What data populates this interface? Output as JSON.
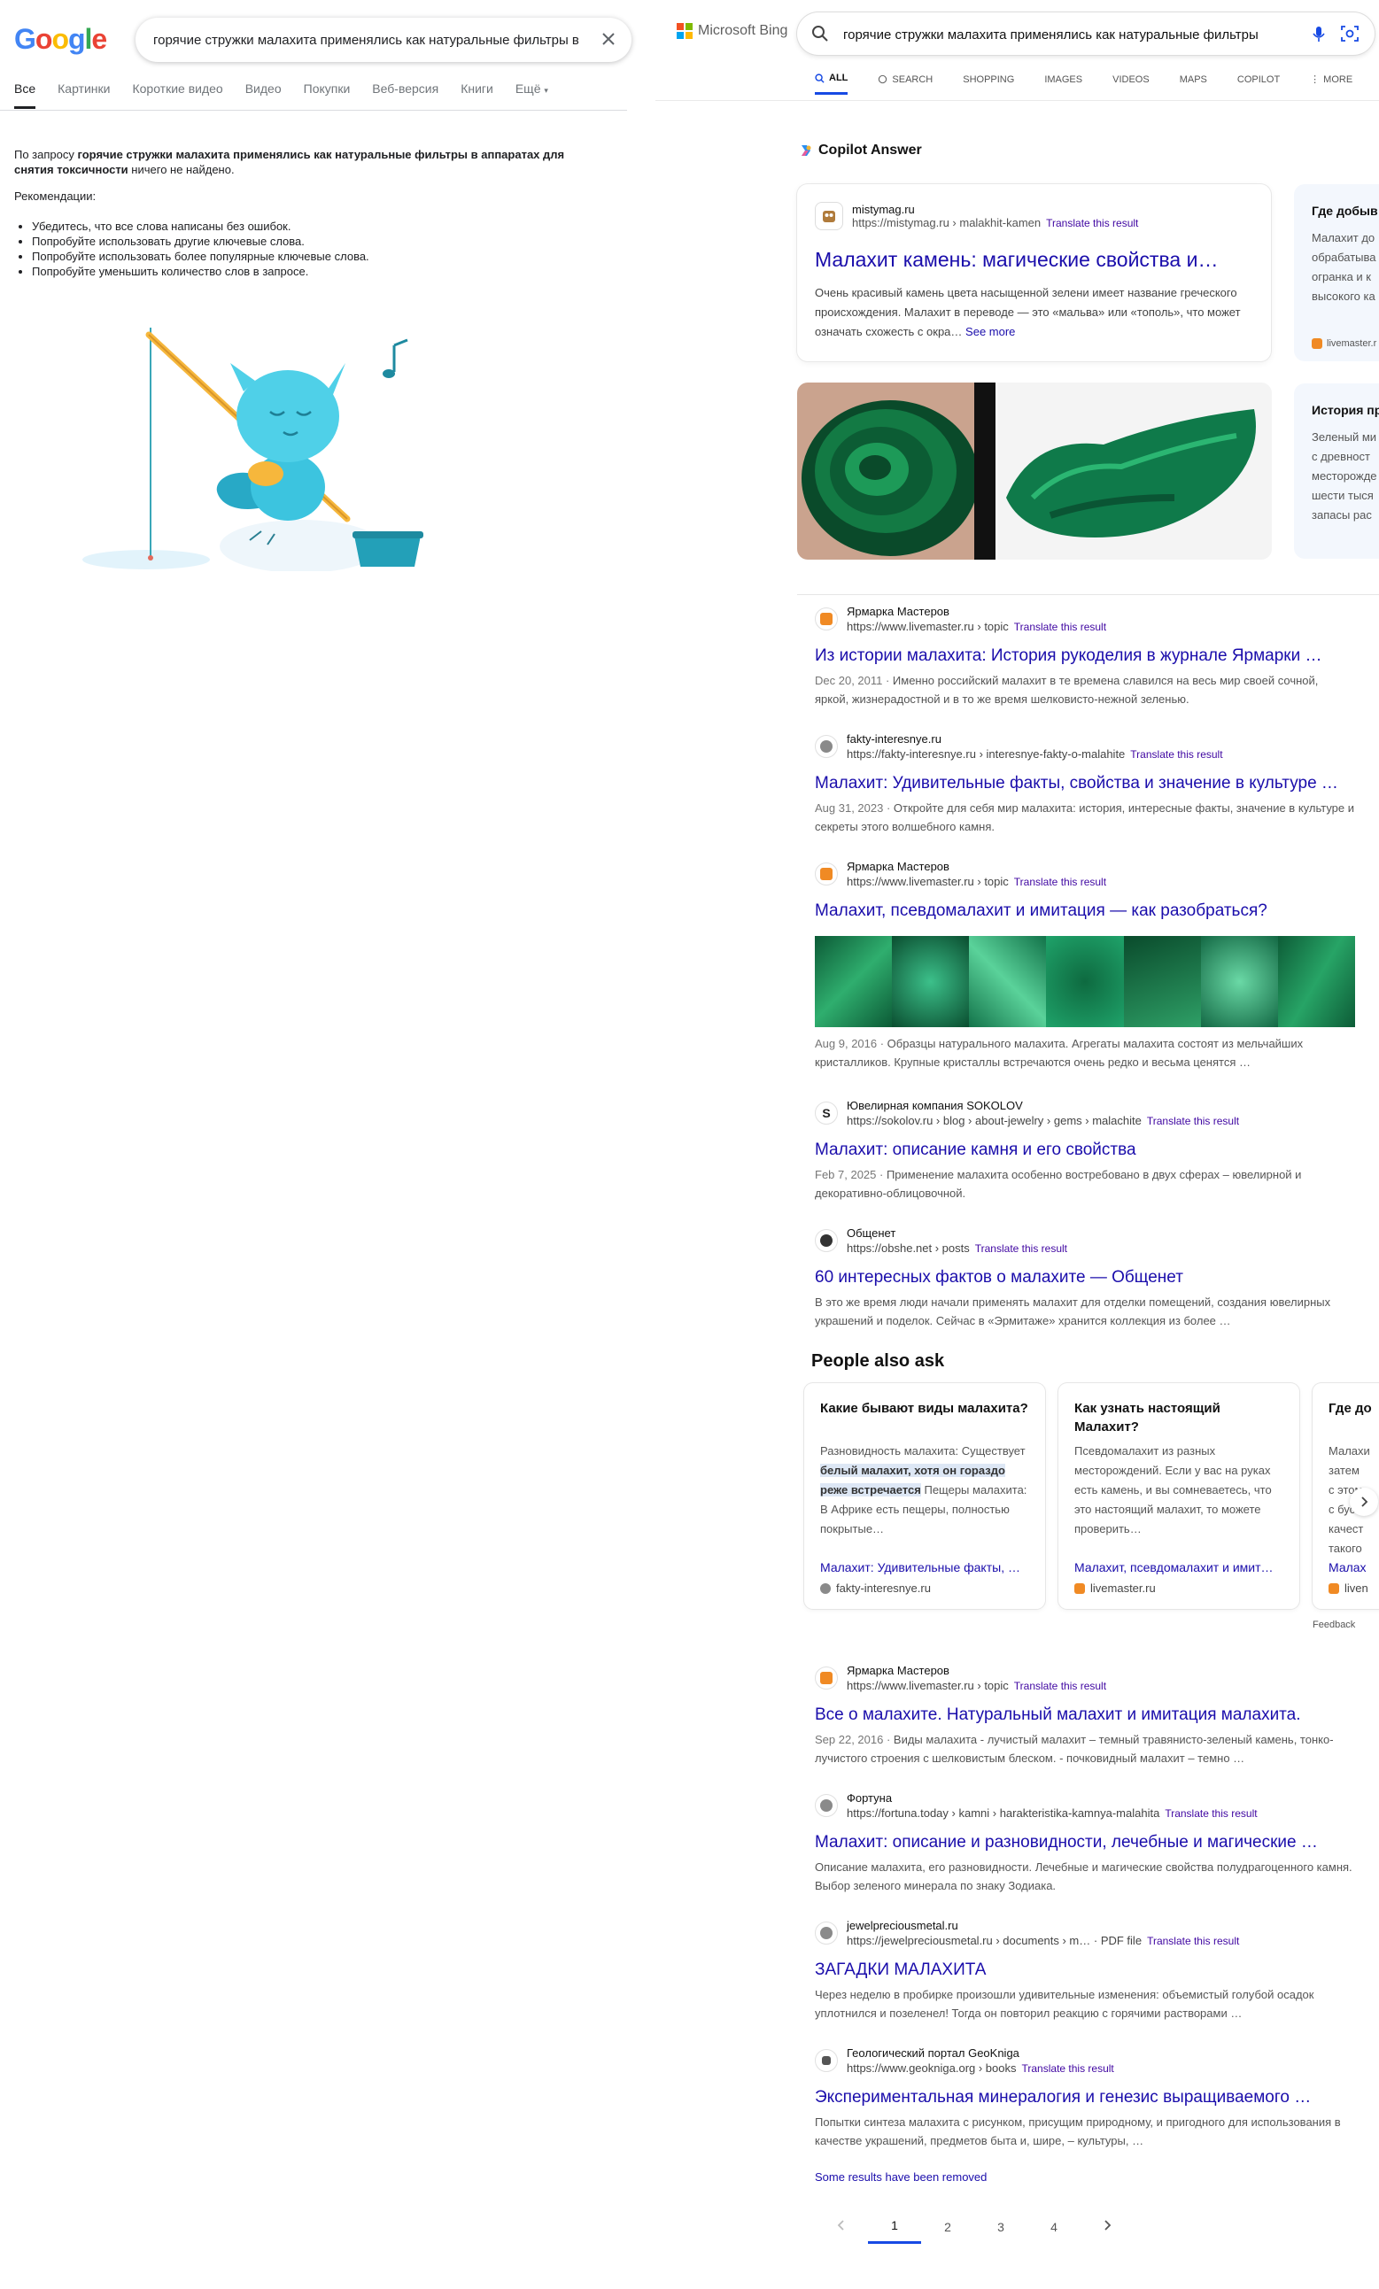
{
  "google": {
    "logo": [
      "G",
      "o",
      "o",
      "g",
      "l",
      "e"
    ],
    "logo_colors": [
      "#4285f4",
      "#ea4335",
      "#fbbc05",
      "#4285f4",
      "#34a853",
      "#ea4335"
    ],
    "query": "горячие стружки малахита применялись как натуральные фильтры в аппаратах для снятия токсичности",
    "tabs": [
      "Все",
      "Картинки",
      "Короткие видео",
      "Видео",
      "Покупки",
      "Веб-версия",
      "Книги",
      "Ещё"
    ],
    "no_results_prefix": "По запросу ",
    "no_results_query": "горячие стружки малахита применялись как натуральные фильтры в аппаратах для снятия токсичности",
    "no_results_suffix": " ничего не найдено.",
    "recommendations_label": "Рекомендации:",
    "recommendations": [
      "Убедитесь, что все слова написаны без ошибок.",
      "Попробуйте использовать другие ключевые слова.",
      "Попробуйте использовать более популярные ключевые слова.",
      "Попробуйте уменьшить количество слов в запросе."
    ]
  },
  "bing": {
    "logo_text": "Microsoft Bing",
    "logo_colors": [
      "#f25022",
      "#7fba00",
      "#00a4ef",
      "#ffb900"
    ],
    "query": "горячие стружки малахита применялись как натуральные фильтры в аппаратах для снятия токсичности",
    "tabs": [
      "ALL",
      "SEARCH",
      "SHOPPING",
      "IMAGES",
      "VIDEOS",
      "MAPS",
      "COPILOT",
      "MORE"
    ],
    "copilot": {
      "title": "Copilot Answer",
      "site": "mistymag.ru",
      "url": "https://mistymag.ru › malakhit-kamen",
      "translate": "Translate this result",
      "link": "Малахит камень: магические свойства и…",
      "snippet": "Очень красивый камень цвета насыщенной зелени имеет название греческого происхождения. Малахит в переводе — это «мальва» или «тополь», что может означать схожесть с окра…",
      "see_more": "See more",
      "side1_title": "Где добыв",
      "side1_lines": [
        "Малахит до",
        "обрабатыва",
        "огранка и к",
        "высокого ка"
      ],
      "side1_src": "livemaster.r",
      "side2_title": "История пр",
      "side2_lines": [
        "Зеленый ми",
        "с древност",
        "месторожде",
        "шести тыся",
        "запасы рас"
      ]
    },
    "results": [
      {
        "site": "Ярмарка Мастеров",
        "url": "https://www.livemaster.ru › topic",
        "translate": "Translate this result",
        "title": "Из истории малахита: История рукоделия в журнале Ярмарки …",
        "date": "Dec 20, 2011 · ",
        "snippet": "Именно российский малахит в те времена славился на весь мир своей сочной, яркой, жизнерадостной и в то же время шелковисто-нежной зеленью.",
        "fav": "#f08a24"
      },
      {
        "site": "fakty-interesnye.ru",
        "url": "https://fakty-interesnye.ru › interesnye-fakty-o-malahite",
        "translate": "Translate this result",
        "title": "Малахит: Удивительные факты, свойства и значение в культуре …",
        "date": "Aug 31, 2023 · ",
        "snippet": "Откройте для себя мир малахита: история, интересные факты, значение в культуре и секреты этого волшебного камня.",
        "fav": "#8a8a8a"
      },
      {
        "site": "Ярмарка Мастеров",
        "url": "https://www.livemaster.ru › topic",
        "translate": "Translate this result",
        "title": "Малахит, псевдомалахит и имитация — как разобраться?",
        "date": "Aug 9, 2016 · ",
        "snippet": "Образцы натурального малахита. Агрегаты малахита состоят из мельчайших кристалликов. Крупные кристаллы встречаются очень редко и весьма ценятся …",
        "fav": "#f08a24"
      },
      {
        "site": "Ювелирная компания SOKOLOV",
        "url": "https://sokolov.ru › blog › about-jewelry › gems › malachite",
        "translate": "Translate this result",
        "title": "Малахит: описание камня и его свойства",
        "date": "Feb 7, 2025 · ",
        "snippet": "Применение малахита особенно востребовано в двух сферах – ювелирной и декоративно-облицовочной.",
        "fav": "#222222"
      },
      {
        "site": "Общенет",
        "url": "https://obshe.net › posts",
        "translate": "Translate this result",
        "title": "60 интересных фактов о малахите — Общенет",
        "date": "",
        "snippet": "В это же время люди начали применять малахит для отделки помещений, создания ювелирных украшений и поделок. Сейчас в «Эрмитаже» хранится коллекция из более …",
        "fav": "#333333"
      },
      {
        "site": "Ярмарка Мастеров",
        "url": "https://www.livemaster.ru › topic",
        "translate": "Translate this result",
        "title": "Все о малахите. Натуральный малахит и имитация малахита.",
        "date": "Sep 22, 2016 · ",
        "snippet": "Виды малахита - лучистый малахит – темный травянисто-зеленый камень, тонко-лучистого строения с шелковистым блеском. - почковидный малахит – темно …",
        "fav": "#f08a24"
      },
      {
        "site": "Фортуна",
        "url": "https://fortuna.today › kamni › harakteristika-kamnya-malahita",
        "translate": "Translate this result",
        "title": "Малахит: описание и разновидности, лечебные и магические …",
        "date": "",
        "snippet": "Описание малахита, его разновидности. Лечебные и магические свойства полудрагоценного камня. Выбор зеленого минерала по знаку Зодиака.",
        "fav": "#8a8a8a"
      },
      {
        "site": "jewelpreciousmetal.ru",
        "url": "https://jewelpreciousmetal.ru › documents › m… · PDF file",
        "translate": "Translate this result",
        "title": "ЗАГАДКИ МАЛАХИТА",
        "date": "",
        "snippet": "Через неделю в пробирке произошли удивительные изменения: объемистый голубой осадок уплотнился и позеленел! Тогда он повторил реакцию с горячими растворами …",
        "fav": "#8a8a8a"
      },
      {
        "site": "Геологический портал GeoKniga",
        "url": "https://www.geokniga.org › books",
        "translate": "Translate this result",
        "title": "Экспериментальная минералогия и генезис выращиваемого …",
        "date": "",
        "snippet": "Попытки синтеза малахита с рисунком, присущим природному, и пригодного для использования в качестве украшений, предметов быта и, шире, – культуры, …",
        "fav": "#555555"
      }
    ],
    "paa": {
      "title": "People also ask",
      "cards": [
        {
          "q": "Какие бывают виды малахита?",
          "a_pre": "Разновидность малахита: Существует ",
          "a_hl": "белый малахит, хотя он гораздо реже встречается",
          "a_post": " Пещеры малахита: В Африке есть пещеры, полностью покрытые…",
          "link": "Малахит: Удивительные факты, …",
          "src": "fakty-interesnye.ru",
          "fav": "#8a8a8a"
        },
        {
          "q": "Как узнать настоящий Малахит?",
          "a_pre": "Псевдомалахит из разных месторождений. Если у вас на руках есть камень, и вы сомневаетесь, что это настоящий малахит, то можете проверить…",
          "a_hl": "",
          "a_post": "",
          "link": "Малахит, псевдомалахит и имит…",
          "src": "livemaster.ru",
          "fav": "#f08a24"
        },
        {
          "q": "Где до",
          "a_pre": "Малахи затем с этом с буси качест такого",
          "a_hl": "",
          "a_post": "",
          "link": "Малах",
          "src": "liven",
          "fav": "#f08a24"
        }
      ],
      "feedback": "Feedback"
    },
    "removed_note": "Some results have been removed",
    "pages": [
      "1",
      "2",
      "3",
      "4"
    ]
  }
}
